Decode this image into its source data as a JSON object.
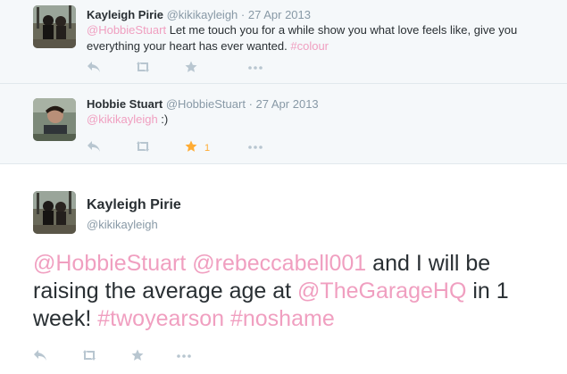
{
  "tweets": [
    {
      "name": "Kayleigh Pirie",
      "handle": "@kikikayleigh",
      "sep": "·",
      "date": "27 Apr 2013",
      "text_parts": [
        {
          "t": "@HobbieStuart",
          "link": true
        },
        {
          "t": " Let me touch you for a while show you what love feels like, give you everything your heart has ever wanted. ",
          "link": false
        },
        {
          "t": "#colour",
          "link": true
        }
      ]
    },
    {
      "name": "Hobbie Stuart",
      "handle": "@HobbieStuart",
      "sep": "·",
      "date": "27 Apr 2013",
      "text_parts": [
        {
          "t": "@kikikayleigh",
          "link": true
        },
        {
          "t": " :)",
          "link": false
        }
      ],
      "fav_count": "1"
    },
    {
      "name": "Kayleigh Pirie",
      "handle": "@kikikayleigh",
      "text_parts": [
        {
          "t": "@HobbieStuart",
          "link": true
        },
        {
          "t": " ",
          "link": false
        },
        {
          "t": "@rebeccabell001",
          "link": true
        },
        {
          "t": " and I will be raising the average age at ",
          "link": false
        },
        {
          "t": "@TheGarageHQ",
          "link": true
        },
        {
          "t": " in 1 week! ",
          "link": false
        },
        {
          "t": "#twoyearson",
          "link": true
        },
        {
          "t": " ",
          "link": false
        },
        {
          "t": "#noshame",
          "link": true
        }
      ]
    }
  ],
  "icons": {
    "reply": "reply-icon",
    "retweet": "retweet-icon",
    "favorite": "star-icon",
    "more": "more-icon"
  },
  "colors": {
    "link": "#f09fc0",
    "muted": "#8899a6",
    "favorite_active": "#ffac33",
    "background_conversation": "#f5f8fa"
  }
}
